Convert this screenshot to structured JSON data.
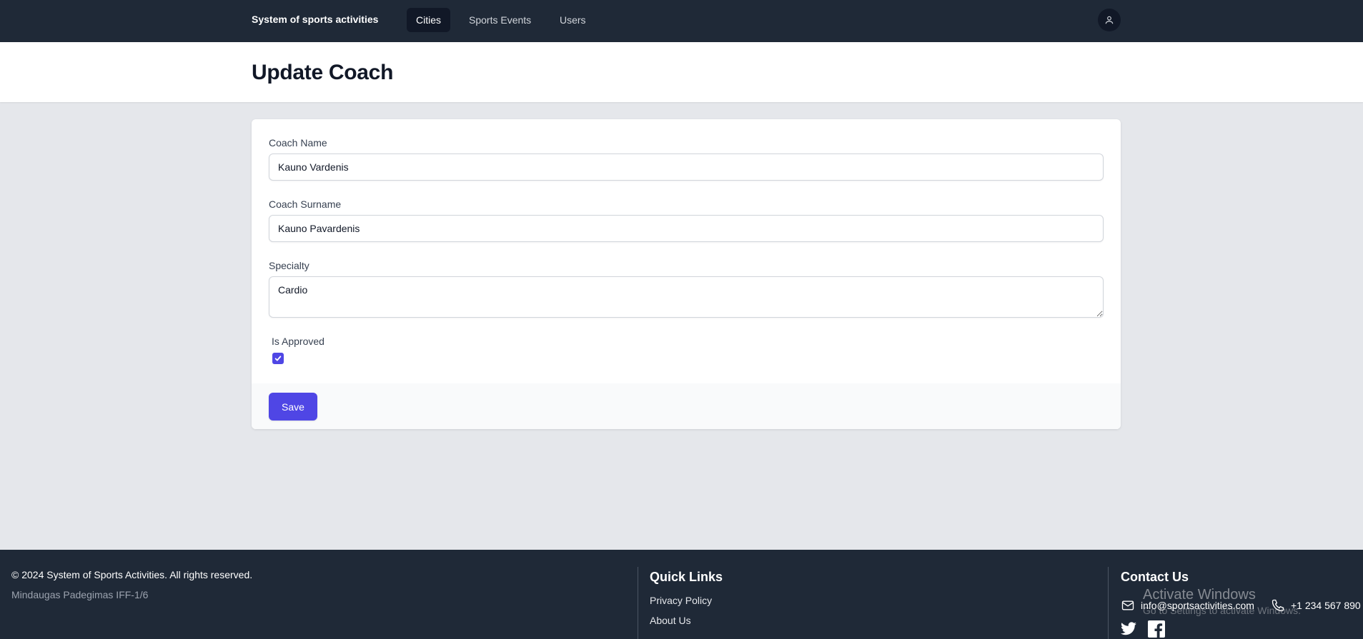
{
  "nav": {
    "brand": "System of sports activities",
    "links": [
      {
        "label": "Cities",
        "active": true
      },
      {
        "label": "Sports Events",
        "active": false
      },
      {
        "label": "Users",
        "active": false
      }
    ],
    "user_icon": "user-icon"
  },
  "header": {
    "title": "Update Coach"
  },
  "form": {
    "coach_name": {
      "label": "Coach Name",
      "value": "Kauno Vardenis"
    },
    "coach_surname": {
      "label": "Coach Surname",
      "value": "Kauno Pavardenis"
    },
    "specialty": {
      "label": "Specialty",
      "value": "Cardio"
    },
    "is_approved": {
      "label": "Is Approved",
      "checked": true
    },
    "save_label": "Save"
  },
  "footer": {
    "copyright": "© 2024 System of Sports Activities. All rights reserved.",
    "author": "Mindaugas Padegimas IFF-1/6",
    "quick_links": {
      "title": "Quick Links",
      "items": [
        "Privacy Policy",
        "About Us"
      ]
    },
    "contact": {
      "title": "Contact Us",
      "email": "info@sportsactivities.com",
      "phone": "+1 234 567 890",
      "social_icons": [
        "twitter-icon",
        "facebook-icon"
      ]
    },
    "watermark": {
      "line1": "Activate Windows",
      "line2": "Go to Settings to activate Windows."
    }
  },
  "colors": {
    "navbar_bg": "#1f2937",
    "active_nav_bg": "#111827",
    "page_bg": "#e5e7eb",
    "accent": "#4f46e5"
  }
}
